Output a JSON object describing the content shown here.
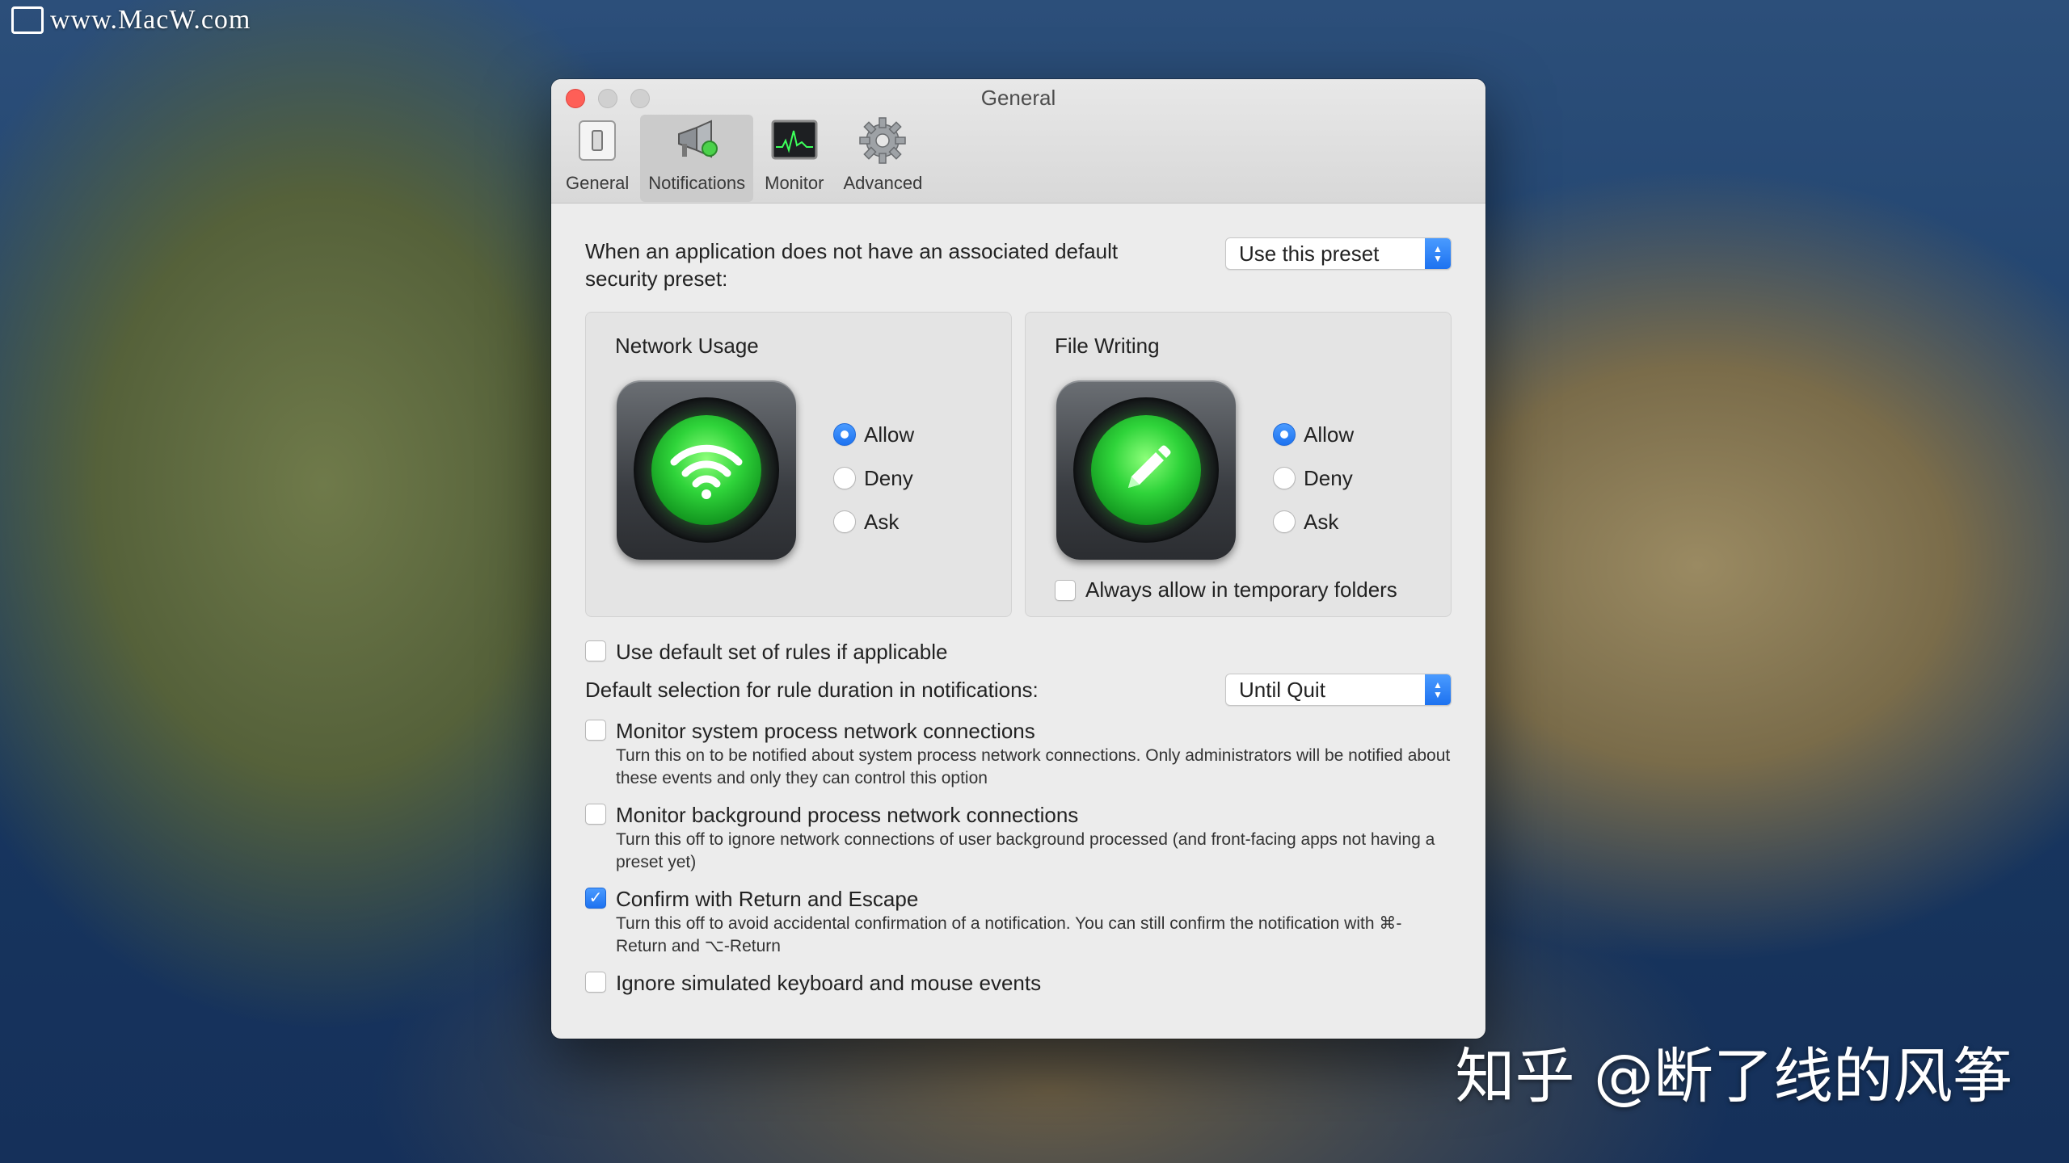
{
  "watermark": {
    "site": "www.MacW.com",
    "author": "知乎 @断了线的风筝"
  },
  "window": {
    "title": "General"
  },
  "toolbar": {
    "items": [
      {
        "label": "General"
      },
      {
        "label": "Notifications"
      },
      {
        "label": "Monitor"
      },
      {
        "label": "Advanced"
      }
    ],
    "active": "Notifications"
  },
  "preset": {
    "label": "When an application does not have an associated default security preset:",
    "value": "Use this preset"
  },
  "network_usage": {
    "title": "Network Usage",
    "options": [
      "Allow",
      "Deny",
      "Ask"
    ],
    "selected": "Allow"
  },
  "file_writing": {
    "title": "File Writing",
    "options": [
      "Allow",
      "Deny",
      "Ask"
    ],
    "selected": "Allow",
    "temp_folders_label": "Always allow in temporary folders",
    "temp_folders_checked": false
  },
  "default_rules": {
    "label": "Use default set of rules if applicable",
    "checked": false
  },
  "duration": {
    "label": "Default selection for rule duration in notifications:",
    "value": "Until Quit"
  },
  "options": [
    {
      "label": "Monitor system process network connections",
      "desc": "Turn this on to be notified about system process network connections. Only administrators will be notified about these events and only they can control this option",
      "checked": false
    },
    {
      "label": "Monitor background process network connections",
      "desc": "Turn this off to ignore network connections of user background processed (and front-facing apps not having a preset yet)",
      "checked": false
    },
    {
      "label": "Confirm with Return and Escape",
      "desc": "Turn this off to avoid accidental confirmation of a notification. You can still confirm the notification with ⌘-Return and ⌥-Return",
      "checked": true
    },
    {
      "label": "Ignore simulated keyboard and mouse events",
      "desc": "",
      "checked": false
    }
  ],
  "colors": {
    "accent": "#1d72f0",
    "close": "#fe5f57",
    "lens": "#2fd43a"
  }
}
